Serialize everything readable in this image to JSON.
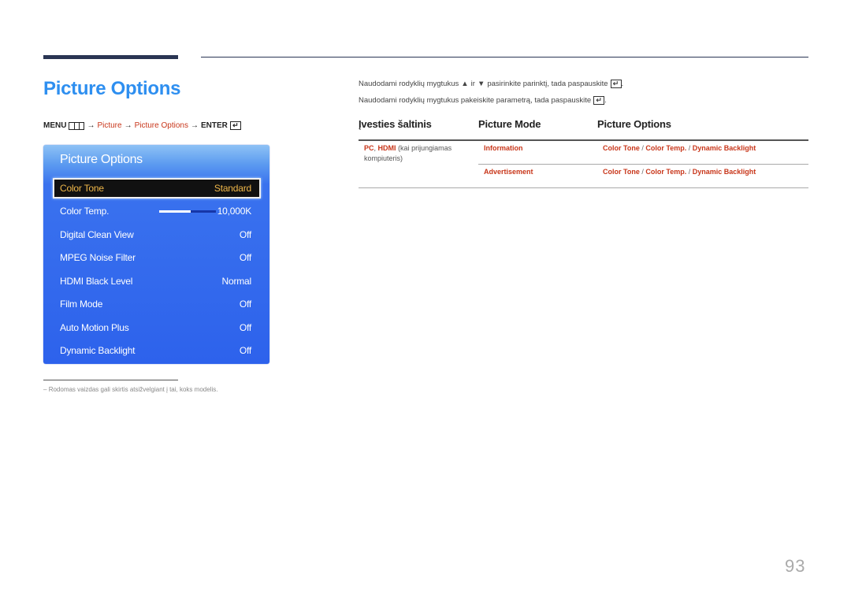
{
  "page": {
    "title": "Picture Options",
    "page_number": "93"
  },
  "menu_path": {
    "menu_label": "MENU",
    "arrow": "→",
    "step1": "Picture",
    "step2": "Picture Options",
    "enter_label": "ENTER",
    "enter_glyph": "↵"
  },
  "osd": {
    "title": "Picture Options",
    "items": [
      {
        "label": "Color Tone",
        "value": "Standard",
        "selected": true
      },
      {
        "label": "Color Temp.",
        "value": "10,000K",
        "slider_fraction": 0.55
      },
      {
        "label": "Digital Clean View",
        "value": "Off"
      },
      {
        "label": "MPEG Noise Filter",
        "value": "Off"
      },
      {
        "label": "HDMI Black Level",
        "value": "Normal"
      },
      {
        "label": "Film Mode",
        "value": "Off"
      },
      {
        "label": "Auto Motion Plus",
        "value": "Off"
      },
      {
        "label": "Dynamic Backlight",
        "value": "Off"
      }
    ]
  },
  "instructions": {
    "line1_a": "Naudodami rodyklių mygtukus",
    "up_glyph": "▲",
    "line1_b": "ir",
    "down_glyph": "▼",
    "line1_c": "pasirinkite parinktį, tada paspauskite",
    "line2": "Naudodami rodyklių mygtukus pakeiskite parametrą, tada paspauskite",
    "enter_glyph": "↵",
    "period": "."
  },
  "table": {
    "headers": [
      "Įvesties šaltinis",
      "Picture Mode",
      "Picture Options"
    ],
    "source": {
      "pc": "PC",
      "comma": ",",
      "hdmi": "HDMI",
      "note": "(kai prijungiamas",
      "note2": "kompiuteris)"
    },
    "rows": [
      {
        "mode": "Information",
        "options": [
          "Color Tone",
          "Color Temp.",
          "Dynamic Backlight"
        ]
      },
      {
        "mode": "Advertisement",
        "options": [
          "Color Tone",
          "Color Temp.",
          "Dynamic Backlight"
        ]
      }
    ],
    "separator": "/"
  },
  "footnote": {
    "dash": "–",
    "text": "Rodomas vaizdas gali skirtis atsižvelgiant į tai, koks modelis."
  },
  "colors": {
    "title_blue": "#2e8ff0",
    "link_red": "#c8361a",
    "osd_blue": "#2d62ec",
    "selected_text": "#f0b84a"
  }
}
